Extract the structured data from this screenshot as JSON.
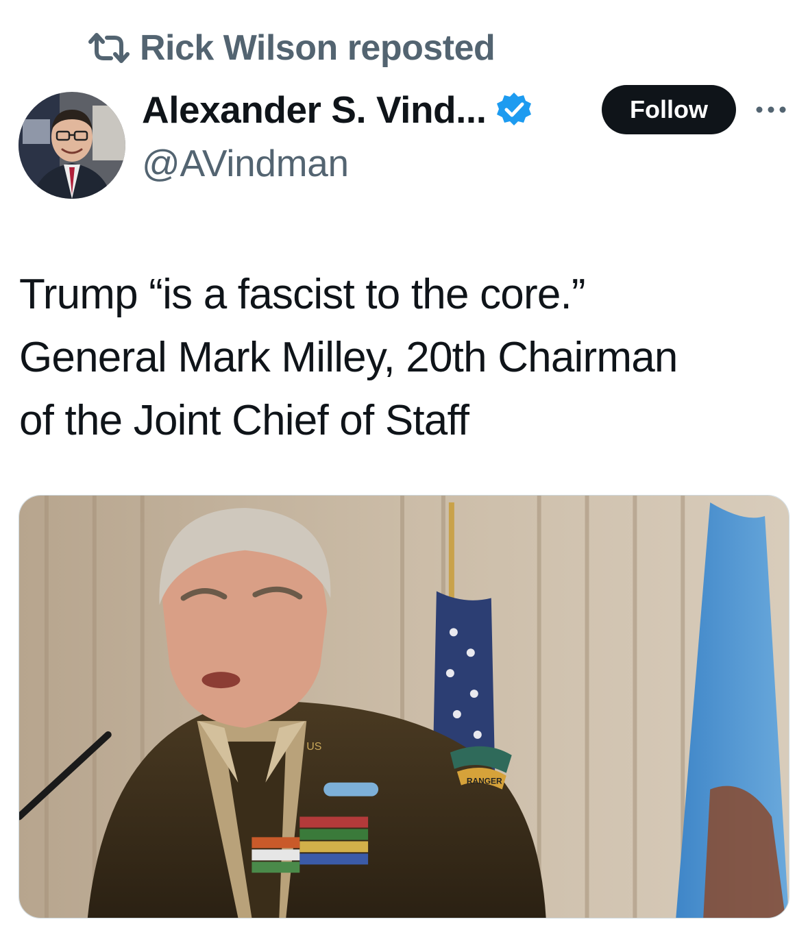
{
  "repost": {
    "label": "Rick Wilson reposted",
    "icon": "repost-icon"
  },
  "author": {
    "display_name": "Alexander S. Vind...",
    "handle": "@AVindman",
    "verified": true,
    "verified_color": "#1d9bf0",
    "avatar_icon": "avatar-photo"
  },
  "actions": {
    "follow_label": "Follow",
    "more_icon": "more-icon"
  },
  "tweet": {
    "lines": [
      "Trump “is a fascist to the core.”",
      "General Mark Milley, 20th Chairman",
      "of the Joint Chief of Staff"
    ]
  },
  "media": {
    "type": "photo",
    "badge_text": "RANGER",
    "collar_text": "US"
  },
  "colors": {
    "text_primary": "#0f1419",
    "text_secondary": "#536471",
    "accent": "#1d9bf0",
    "follow_bg": "#0f1419"
  }
}
